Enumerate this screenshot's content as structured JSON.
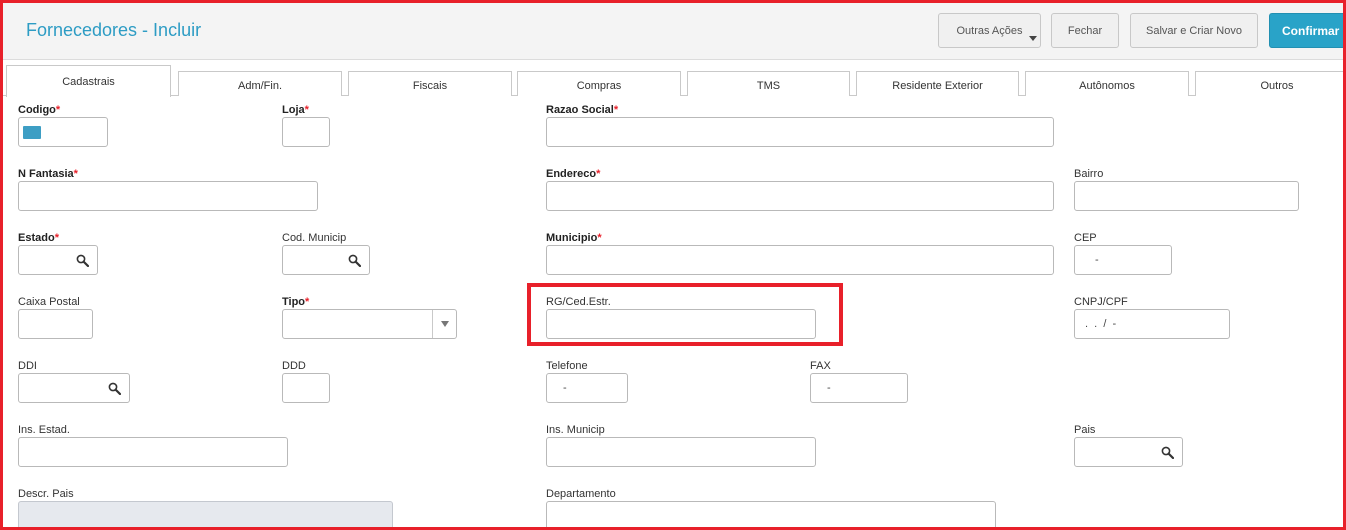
{
  "page": {
    "title": "Fornecedores - Incluir"
  },
  "actions": {
    "more": "Outras Ações",
    "close": "Fechar",
    "save_new": "Salvar e Criar Novo",
    "confirm": "Confirmar"
  },
  "tabs": [
    "Cadastrais",
    "Adm/Fin.",
    "Fiscais",
    "Compras",
    "TMS",
    "Residente Exterior",
    "Autônomos",
    "Outros"
  ],
  "active_tab": "Cadastrais",
  "fields": {
    "codigo": {
      "label": "Codigo",
      "required": "*"
    },
    "loja": {
      "label": "Loja",
      "required": "*"
    },
    "razao_social": {
      "label": "Razao Social",
      "required": "*"
    },
    "n_fantasia": {
      "label": "N Fantasia",
      "required": "*"
    },
    "endereco": {
      "label": "Endereco",
      "required": "*"
    },
    "bairro": {
      "label": "Bairro"
    },
    "estado": {
      "label": "Estado",
      "required": "*"
    },
    "cod_municip": {
      "label": "Cod. Municip"
    },
    "municipio": {
      "label": "Municipio",
      "required": "*"
    },
    "cep": {
      "label": "CEP",
      "mask": "-"
    },
    "caixa_postal": {
      "label": "Caixa Postal"
    },
    "tipo": {
      "label": "Tipo",
      "required": "*"
    },
    "rg_ced": {
      "label": "RG/Ced.Estr."
    },
    "cnpj_cpf": {
      "label": "CNPJ/CPF",
      "mask": ".  .  /  -"
    },
    "ddi": {
      "label": "DDI"
    },
    "ddd": {
      "label": "DDD"
    },
    "telefone": {
      "label": "Telefone",
      "mask": "-"
    },
    "fax": {
      "label": "FAX",
      "mask": "-"
    },
    "ins_estad": {
      "label": "Ins. Estad."
    },
    "ins_municip": {
      "label": "Ins. Municip"
    },
    "pais": {
      "label": "Pais"
    },
    "descr_pais": {
      "label": "Descr. Pais"
    },
    "departamento": {
      "label": "Departamento"
    }
  },
  "colors": {
    "accent": "#29a3c8",
    "title": "#2d9cc4",
    "required": "#e8202a",
    "highlight": "#e8202a"
  }
}
